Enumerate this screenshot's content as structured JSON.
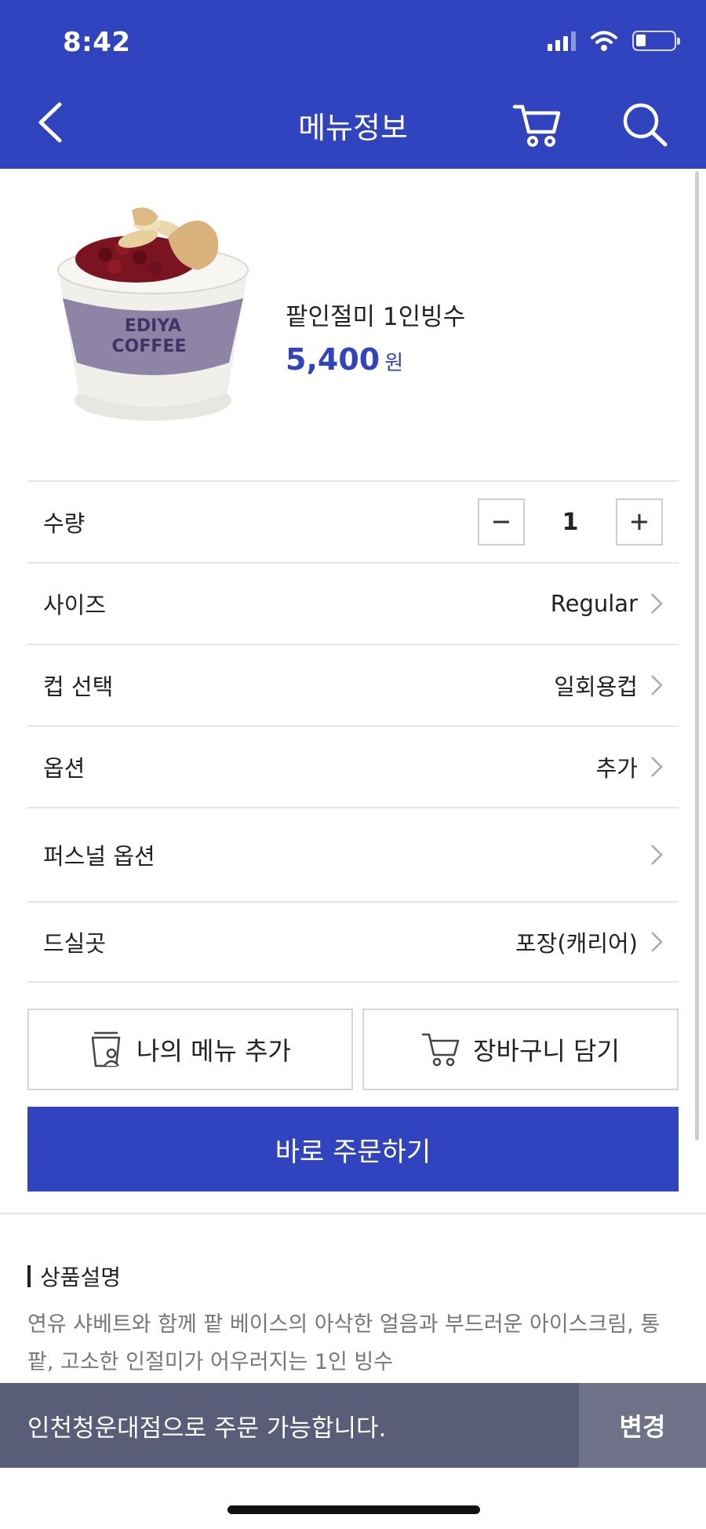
{
  "status_bar": {
    "time": "8:42"
  },
  "nav": {
    "title": "메뉴정보"
  },
  "product": {
    "name": "팥인절미 1인빙수",
    "price": "5,400",
    "price_unit": "원",
    "cup_text": "EDIYA COFFEE"
  },
  "options": {
    "quantity_label": "수량",
    "quantity_value": "1",
    "size_label": "사이즈",
    "size_value": "Regular",
    "cup_label": "컵 선택",
    "cup_value": "일회용컵",
    "option_label": "옵션",
    "option_value": "추가",
    "personal_label": "퍼스널 옵션",
    "dining_label": "드실곳",
    "dining_value": "포장(캐리어)"
  },
  "actions": {
    "my_menu_label": "나의 메뉴 추가",
    "cart_label": "장바구니 담기",
    "order_label": "바로 주문하기"
  },
  "description": {
    "title": "상품설명",
    "text": "연유 샤베트와 함께 팥 베이스의 아삭한 얼음과 부드러운 아이스크림, 통팥, 고소한 인절미가 어우러지는 1인 빙수"
  },
  "store": {
    "text": "인천청운대점으로 주문 가능합니다.",
    "change_label": "변경"
  },
  "colors": {
    "primary": "#3044bf",
    "store_bar": "#5a5d78"
  }
}
